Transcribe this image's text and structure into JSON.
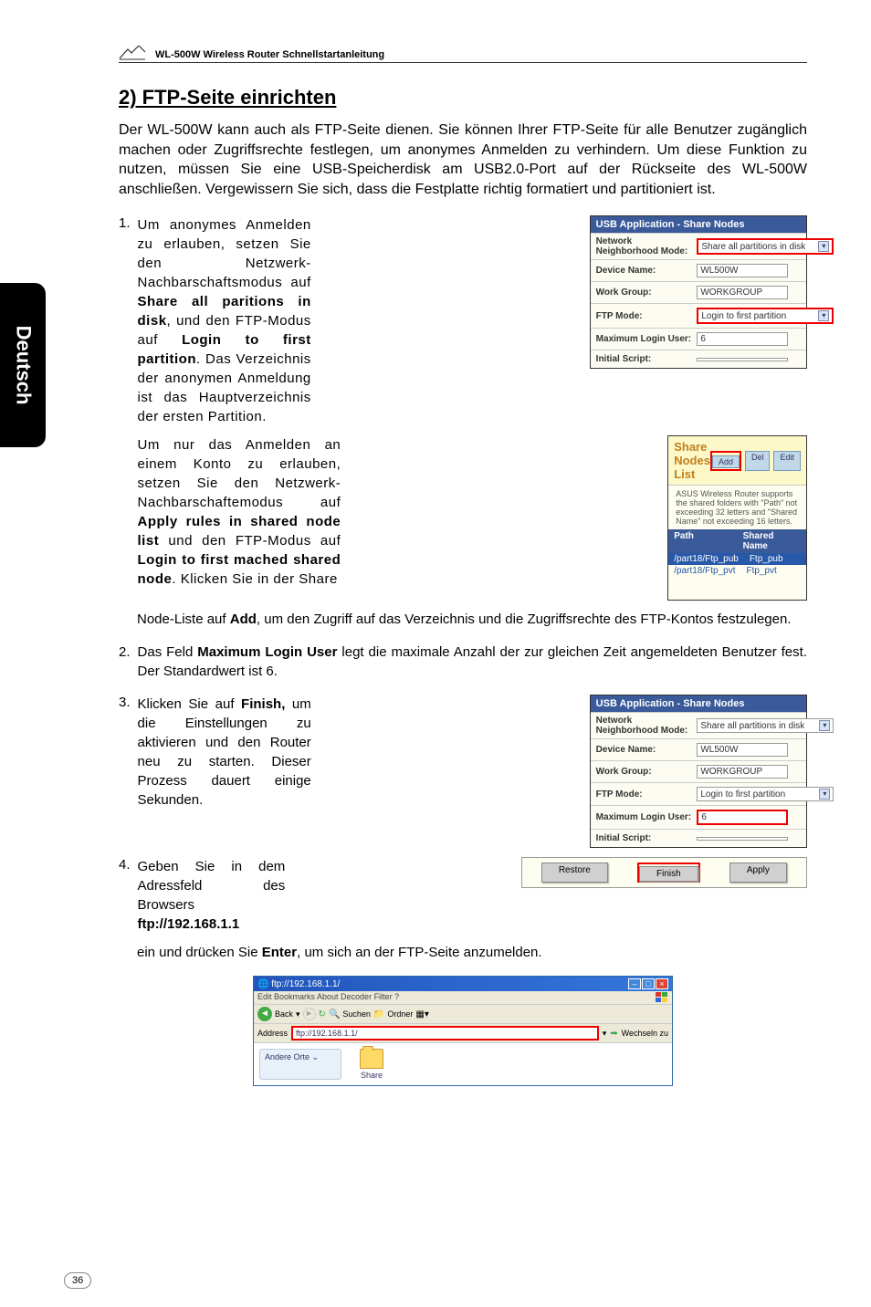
{
  "header": {
    "product": "WL-500W Wireless Router Schnellstartanleitung"
  },
  "sideTab": "Deutsch",
  "section": {
    "title": "2) FTP-Seite einrichten",
    "intro": "Der WL-500W kann auch als FTP-Seite dienen. Sie können Ihrer FTP-Seite für alle Benutzer zugänglich machen oder Zugriffsrechte festlegen, um anonymes Anmelden zu verhindern. Um diese Funktion zu nutzen, müssen Sie eine USB-Speicherdisk am USB2.0-Port auf der Rückseite des WL-500W anschließen. Vergewissern Sie sich, dass die Festplatte richtig formatiert und partitioniert ist."
  },
  "step1": {
    "num": "1.",
    "textA": "Um anonymes Anmelden zu erlauben, setzen Sie den Netzwerk-Nachbarschafts­modus auf ",
    "bold1": "Share all paritions in disk",
    "textA2": ", und den FTP-Modus auf ",
    "bold2": "Login to first partition",
    "textA3": ". Das Verzeichnis der anonymen Anmeldung ist das Hauptverzeichnis der ersten Partition.",
    "textB": "Um nur das Anmelden an einem Konto zu erlauben, setzen Sie den Netzwerk-Nachbarschaftemodus auf ",
    "bold3": "Apply rules in shared node list",
    "textB2": " und den FTP-Modus auf ",
    "bold4": "Login to first mached shared node",
    "textB3": ". Klicken Sie in der Share",
    "textCont": "Node-Liste auf ",
    "bold5": "Add",
    "textCont2": ", um den Zugriff auf das Verzeichnis und die Zugriffsrechte des FTP-Kontos festzulegen."
  },
  "step2": {
    "num": "2.",
    "textA": "Das Feld ",
    "bold1": "Maximum Login User",
    "textA2": " legt die maximale Anzahl der zur gleichen Zeit angemeldeten Benutzer fest. Der Standardwert ist 6."
  },
  "step3": {
    "num": "3.",
    "textA": "Klicken Sie auf ",
    "bold1": "Finish,",
    "textA2": " um die Einstellungen zu aktivieren und den Router neu zu starten. Dieser Prozess dauert einige Sekunden."
  },
  "step4": {
    "num": "4.",
    "textA": "Geben Sie in dem Adressfeld des Browsers ",
    "bold1": "ftp://192.168.1.1",
    "textA2": " ein und drücken Sie ",
    "bold2": "Enter",
    "textA3": ", um sich an der FTP-Seite anzumelden."
  },
  "screenshot1": {
    "title": "USB Application - Share Nodes",
    "rows": [
      {
        "label": "Network Neighborhood Mode:",
        "value": "Share all partitions in disk",
        "type": "select",
        "red": true
      },
      {
        "label": "Device Name:",
        "value": "WL500W",
        "type": "input"
      },
      {
        "label": "Work Group:",
        "value": "WORKGROUP",
        "type": "input"
      },
      {
        "label": "FTP Mode:",
        "value": "Login to first partition",
        "type": "select",
        "red": true
      },
      {
        "label": "Maximum Login User:",
        "value": "6",
        "type": "input"
      },
      {
        "label": "Initial Script:",
        "value": "",
        "type": "input"
      }
    ]
  },
  "screenshot2": {
    "title": "Share Nodes List",
    "buttons": [
      "Add",
      "Del",
      "Edit"
    ],
    "desc": "ASUS Wireless Router supports the shared folders with \"Path\" not exceeding 32 letters and \"Shared Name\" not exceeding 16 letters.",
    "headerPath": "Path",
    "headerName": "Shared Name",
    "rows": [
      {
        "path": "/part18/Ftp_pub",
        "name": "Ftp_pub",
        "hl": true
      },
      {
        "path": "/part18/Ftp_pvt",
        "name": "Ftp_pvt",
        "hl": false
      }
    ]
  },
  "screenshot3": {
    "title": "USB Application - Share Nodes",
    "rows": [
      {
        "label": "Network Neighborhood Mode:",
        "value": "Share all partitions in disk",
        "type": "select"
      },
      {
        "label": "Device Name:",
        "value": "WL500W",
        "type": "input"
      },
      {
        "label": "Work Group:",
        "value": "WORKGROUP",
        "type": "input"
      },
      {
        "label": "FTP Mode:",
        "value": "Login to first partition",
        "type": "select"
      },
      {
        "label": "Maximum Login User:",
        "value": "6",
        "type": "input",
        "red": true
      },
      {
        "label": "Initial Script:",
        "value": "",
        "type": "input"
      }
    ]
  },
  "bottomButtons": [
    "Restore",
    "Finish",
    "Apply"
  ],
  "browser": {
    "title": "ftp://192.168.1.1/",
    "menu": "Edit   Bookmarks   About   Decoder   Filter   ?",
    "back": "Back",
    "addressLabel": "Address",
    "address": "ftp://192.168.1.1/",
    "go": "Wechseln zu",
    "sidebar": "Andere Orte",
    "folder": "Share"
  },
  "pageNumber": "36"
}
